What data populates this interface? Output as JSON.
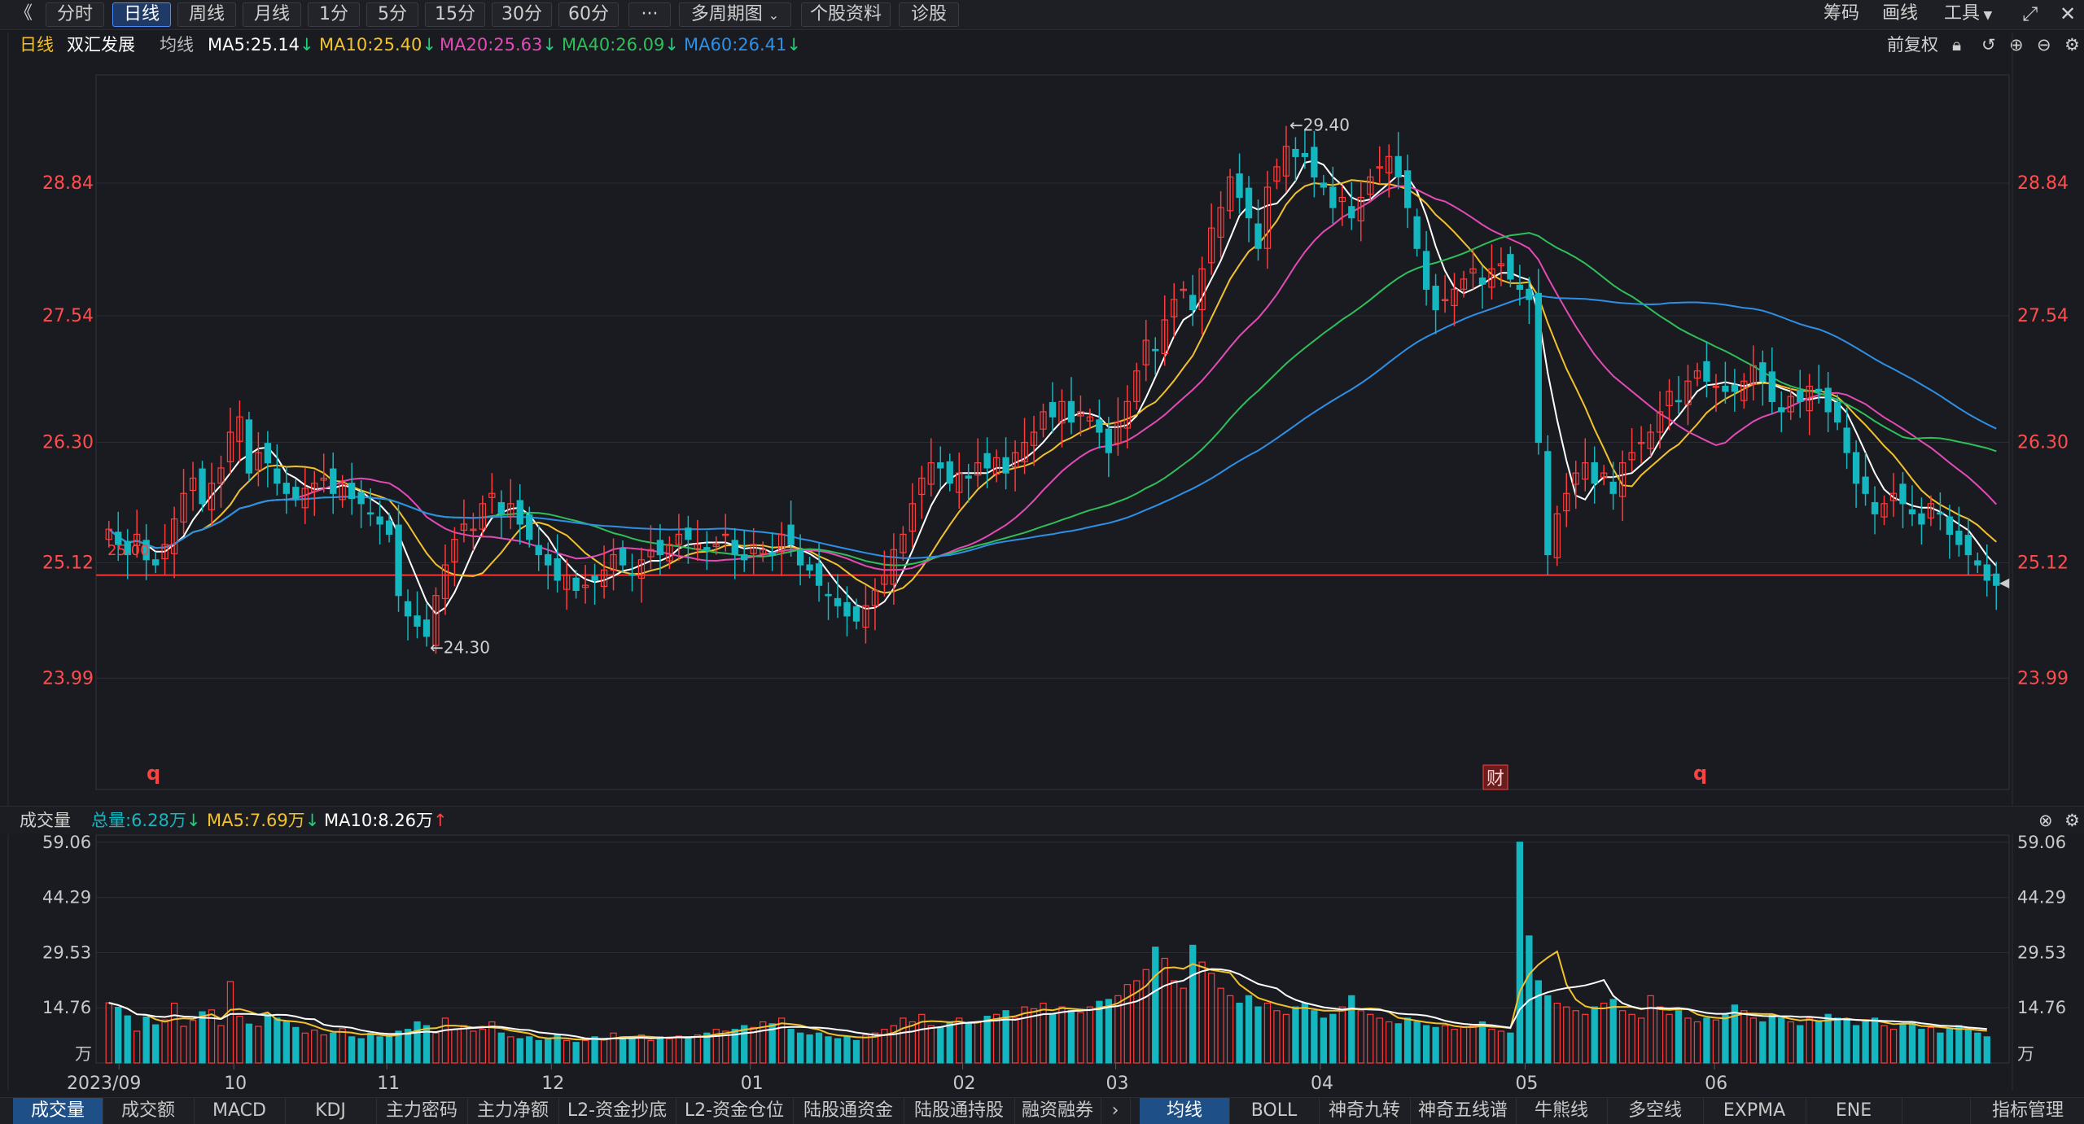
{
  "toolbar": {
    "back_glyph": "《",
    "periods": [
      "分时",
      "日线",
      "周线",
      "月线",
      "1分",
      "5分",
      "15分",
      "30分",
      "60分"
    ],
    "active_period": "日线",
    "more_glyph": "···",
    "multi_period": "多周期图",
    "stock_info": "个股资料",
    "diagnose": "诊股",
    "right": [
      "筹码",
      "画线",
      "工具"
    ]
  },
  "legend": {
    "period": "日线",
    "stock_name": "双汇发展",
    "avg_label": "均线",
    "ma5": "MA5:25.14",
    "ma10": "MA10:25.40",
    "ma20": "MA20:25.63",
    "ma40": "MA40:26.09",
    "ma60": "MA60:26.41",
    "restore": "前复权"
  },
  "volume_legend": {
    "title": "成交量",
    "total": "总量:6.28万",
    "ma5": "MA5:7.69万",
    "ma10": "MA10:8.26万"
  },
  "colors": {
    "up": "#ff3b3b",
    "down": "#14b6c0",
    "ma5": "#ffffff",
    "ma10": "#f2c12e",
    "ma20": "#e24bb6",
    "ma40": "#2fbf5a",
    "ma60": "#2e8fe6",
    "price_label": "#ff4040"
  },
  "price_axis": {
    "ticks": [
      "28.84",
      "27.54",
      "26.30",
      "25.12",
      "23.99"
    ],
    "tick_values": [
      28.84,
      27.54,
      26.3,
      25.12,
      23.99
    ],
    "current_line": 25.0,
    "current_label": "25.00",
    "high_marker": "←29.40",
    "low_marker": "←24.30",
    "event_q": "q",
    "event_cai": "财"
  },
  "time_axis": [
    "2023/09",
    "10",
    "11",
    "12",
    "01",
    "02",
    "03",
    "04",
    "05",
    "06"
  ],
  "volume_axis": {
    "ticks": [
      "59.06",
      "44.29",
      "29.53",
      "14.76"
    ],
    "tick_values": [
      59.06,
      44.29,
      29.53,
      14.76
    ],
    "unit": "万"
  },
  "bottom_tabs_left": [
    "成交量",
    "成交额",
    "MACD",
    "KDJ",
    "主力密码",
    "主力净额",
    "L2-资金抄底",
    "L2-资金仓位",
    "陆股通资金",
    "陆股通持股",
    "融资融券"
  ],
  "bottom_tabs_right": [
    "均线",
    "BOLL",
    "神奇九转",
    "神奇五线谱",
    "牛熊线",
    "多空线",
    "EXPMA",
    "ENE"
  ],
  "bottom_tab_active_left": "成交量",
  "bottom_tab_active_right": "均线",
  "indicator_manage": "指标管理",
  "chart_data": {
    "type": "candlestick",
    "closes": [
      25.45,
      25.3,
      25.2,
      25.4,
      25.15,
      25.1,
      25.3,
      25.55,
      25.8,
      25.95,
      25.7,
      25.9,
      26.05,
      26.4,
      26.55,
      26.0,
      26.2,
      26.1,
      25.9,
      25.8,
      25.75,
      25.85,
      25.9,
      25.95,
      25.8,
      25.9,
      25.75,
      25.7,
      25.6,
      25.5,
      25.4,
      24.8,
      24.6,
      24.5,
      24.4,
      24.8,
      25.1,
      25.35,
      25.5,
      25.45,
      25.7,
      25.8,
      25.6,
      25.7,
      25.5,
      25.35,
      25.2,
      25.1,
      24.95,
      25.0,
      24.85,
      24.9,
      24.95,
      25.05,
      25.2,
      25.1,
      25.0,
      25.15,
      25.25,
      25.2,
      25.3,
      25.4,
      25.35,
      25.3,
      25.25,
      25.3,
      25.4,
      25.2,
      25.15,
      25.3,
      25.25,
      25.2,
      25.4,
      25.3,
      25.1,
      25.05,
      24.9,
      24.8,
      24.7,
      24.6,
      24.55,
      24.7,
      24.85,
      25.0,
      25.25,
      25.4,
      25.7,
      25.95,
      26.1,
      26.05,
      25.9,
      26.0,
      25.95,
      26.1,
      26.05,
      26.15,
      26.0,
      26.2,
      26.3,
      26.4,
      26.6,
      26.55,
      26.7,
      26.5,
      26.6,
      26.55,
      26.4,
      26.2,
      26.5,
      26.7,
      27.0,
      27.3,
      27.2,
      27.5,
      27.7,
      27.8,
      27.6,
      28.0,
      28.4,
      28.6,
      28.9,
      28.7,
      28.5,
      28.2,
      28.8,
      29.0,
      29.2,
      29.1,
      29.1,
      28.9,
      28.8,
      28.6,
      28.7,
      28.5,
      28.7,
      28.9,
      29.0,
      29.1,
      28.9,
      28.6,
      28.2,
      27.8,
      27.6,
      27.7,
      27.8,
      27.9,
      28.0,
      27.85,
      28.0,
      28.05,
      27.9,
      27.8,
      27.7,
      26.3,
      25.2,
      25.6,
      25.8,
      26.0,
      26.1,
      25.9,
      26.0,
      25.8,
      26.1,
      26.2,
      26.3,
      26.4,
      26.6,
      26.8,
      26.7,
      26.9,
      27.0,
      26.9,
      26.85,
      26.8,
      26.8,
      26.9,
      27.05,
      26.9,
      26.7,
      26.6,
      26.75,
      26.7,
      26.85,
      26.8,
      26.6,
      26.5,
      26.2,
      25.9,
      25.8,
      25.6,
      25.7,
      25.8,
      25.7,
      25.6,
      25.5,
      25.7,
      25.6,
      25.4,
      25.3,
      25.2,
      25.1,
      24.95,
      24.9
    ],
    "volumes": [
      16.1,
      14.9,
      12.6,
      8.5,
      12.3,
      10.2,
      11.5,
      16.0,
      9.8,
      11.4,
      13.7,
      14.2,
      10.0,
      21.8,
      12.5,
      10.4,
      9.8,
      13.1,
      12.0,
      11.0,
      9.5,
      8.0,
      8.8,
      7.5,
      8.0,
      9.2,
      7.0,
      6.5,
      8.0,
      7.0,
      7.6,
      8.5,
      9.0,
      11.0,
      10.0,
      8.0,
      12.0,
      9.0,
      10.0,
      8.5,
      9.0,
      11.0,
      8.0,
      7.0,
      6.5,
      7.0,
      6.0,
      6.5,
      7.5,
      6.0,
      5.5,
      6.0,
      7.0,
      6.5,
      8.0,
      7.0,
      6.5,
      7.5,
      6.0,
      7.0,
      6.5,
      7.2,
      6.8,
      7.5,
      8.0,
      9.0,
      8.5,
      9.0,
      10.0,
      9.5,
      11.0,
      10.5,
      12.0,
      9.0,
      8.0,
      7.5,
      8.0,
      7.0,
      6.5,
      7.0,
      6.0,
      7.5,
      8.0,
      9.0,
      10.0,
      12.0,
      11.0,
      13.0,
      10.0,
      9.5,
      11.0,
      12.0,
      10.5,
      11.0,
      12.5,
      13.0,
      14.0,
      12.0,
      15.0,
      14.5,
      16.0,
      13.0,
      15.0,
      14.0,
      13.5,
      15.0,
      16.5,
      17.0,
      18.0,
      21.0,
      22.0,
      25.0,
      31.0,
      28.0,
      22.0,
      20.0,
      31.5,
      27.0,
      24.0,
      20.0,
      18.0,
      16.0,
      18.0,
      15.0,
      16.0,
      14.0,
      13.0,
      15.0,
      16.0,
      14.0,
      12.0,
      13.0,
      15.0,
      18.0,
      14.0,
      13.0,
      12.0,
      11.0,
      10.5,
      12.0,
      11.0,
      10.0,
      9.5,
      10.0,
      9.0,
      9.5,
      10.0,
      11.0,
      9.0,
      8.5,
      8.0,
      59.1,
      34.0,
      22.0,
      18.0,
      16.0,
      15.0,
      14.0,
      13.0,
      15.0,
      16.0,
      17.0,
      14.0,
      13.0,
      12.0,
      18.0,
      15.0,
      13.0,
      14.0,
      12.0,
      11.0,
      12.0,
      11.5,
      13.0,
      15.5,
      14.0,
      12.0,
      11.0,
      13.0,
      12.0,
      11.0,
      10.0,
      12.0,
      11.0,
      13.0,
      12.0,
      11.5,
      10.0,
      11.0,
      12.0,
      10.0,
      9.0,
      10.5,
      11.0,
      9.0,
      9.5,
      8.0,
      9.0,
      10.0,
      9.0,
      8.0,
      7.0
    ]
  }
}
